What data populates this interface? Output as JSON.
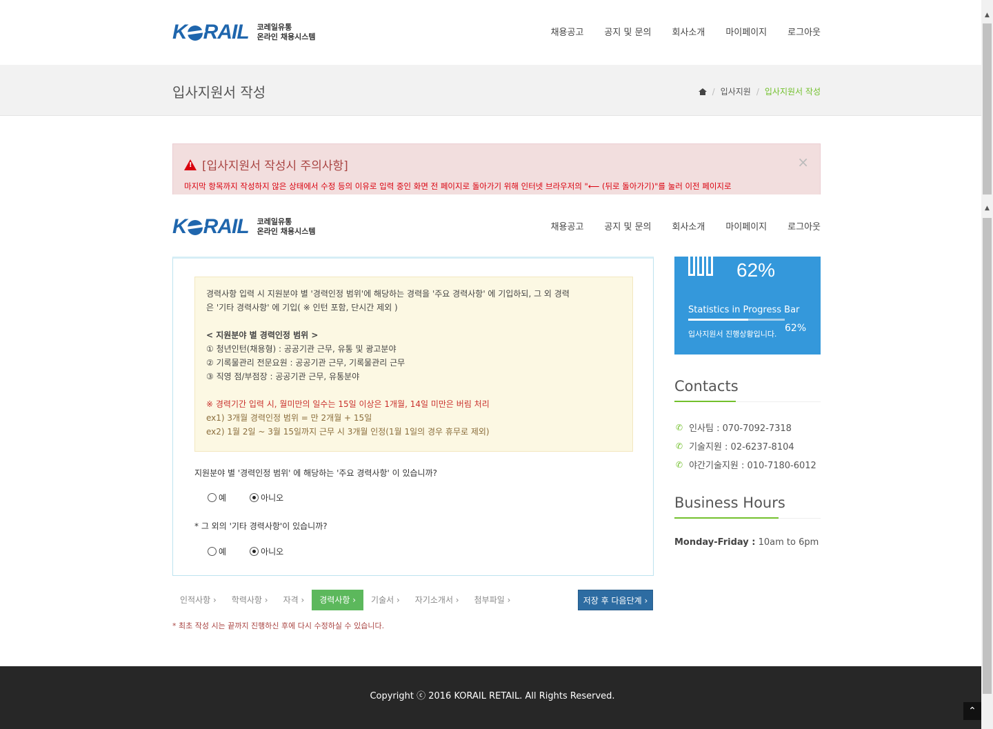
{
  "header": {
    "logo_word_1": "K",
    "logo_word_2": "RAIL",
    "logo_line1": "코레일유통",
    "logo_line2": "온라인 채용시스템",
    "nav": [
      "채용공고",
      "공지 및 문의",
      "회사소개",
      "마이페이지",
      "로그아웃"
    ]
  },
  "page": {
    "title": "입사지원서 작성",
    "breadcrumb": [
      "입사지원",
      "입사지원서 작성"
    ]
  },
  "alert": {
    "title": "[입사지원서 작성시 주의사항]",
    "body": "마지막 항목까지 작성하지 않은 상태에서 수정 등의 이유로 입력 중인 화면 전 페이지로 돌아가기 위해 인터넷 브라우저의 \"⟵ (뒤로 돌아가기)\"를 눌러 이전 페이지로",
    "close": "×"
  },
  "notice": {
    "intro_1": "경력사항 입력 시 지원분야 별 '경력인정 범위'에 해당하는 경력을 '주요 경력사항' 에 기입하되, 그 외 경력",
    "intro_2": "은 '기타 경력사항' 에 기입( ※ 인턴 포함, 단시간 제외 )",
    "range_title": "< 지원분야 별 경력인정 범위 >",
    "range_items": [
      "① 청년인턴(채용형) : 공공기관 근무, 유통 및 광고분야",
      "② 기록물관리 전문요원 : 공공기관 근무, 기록물관리 근무",
      "③ 직영 점/부점장 : 공공기관 근무, 유통분야"
    ],
    "rule": "※ 경력기간 입력 시, 월미만의 일수는 15일 이상은 1개월, 14일 미만은 버림 처리",
    "ex1": "ex1) 3개월 경력인정 범위 = 만 2개월 + 15일",
    "ex2": "ex2) 1월 2일 ~ 3월 15일까지 근무 시 3개월 인정(1월 1일의 경우 휴무로 제외)"
  },
  "questions": {
    "q1": "지원분야 별 '경력인정 범위' 에 해당하는 '주요 경력사항' 이 있습니까?",
    "q2": "* 그 외의 '기타 경력사항'이 있습니까?",
    "yes": "예",
    "no": "아니오",
    "q1_selected": "아니오",
    "q2_selected": "아니오"
  },
  "steps": {
    "items": [
      "인적사항 ›",
      "학력사항 ›",
      "자격 ›",
      "경력사항 ›",
      "기술서 ›",
      "자기소개서 ›",
      "첨부파일 ›"
    ],
    "active_index": 3,
    "next_button": "저장 후 다음단계 ›",
    "footnote": "* 최초 작성 시는 끝까지 진행하신 후에 다시 수정하실 수 있습니다."
  },
  "progress": {
    "value_percent": 62,
    "big_label": "62%",
    "label": "Statistics in Progress Bar",
    "description": "입사지원서 진행상황입니다.",
    "small_label": "62%"
  },
  "contacts": {
    "heading": "Contacts",
    "items": [
      "인사팀 : 070-7092-7318",
      "기술지원 : 02-6237-8104",
      "야간기술지원 : 010-7180-6012"
    ]
  },
  "business_hours": {
    "heading": "Business Hours",
    "days": "Monday-Friday :",
    "time": " 10am to 6pm"
  },
  "footer": {
    "copyright": "Copyright ⓒ 2016 KORAIL RETAIL. All Rights Reserved."
  },
  "colors": {
    "brand_blue": "#1f66ad",
    "accent_green": "#72c02c",
    "progress_blue": "#3498db",
    "alert_red": "#d9000d"
  },
  "icons": [
    "home-icon",
    "warning-icon",
    "close-icon",
    "phone-icon",
    "bar-chart-icon",
    "chevron-up-icon"
  ]
}
